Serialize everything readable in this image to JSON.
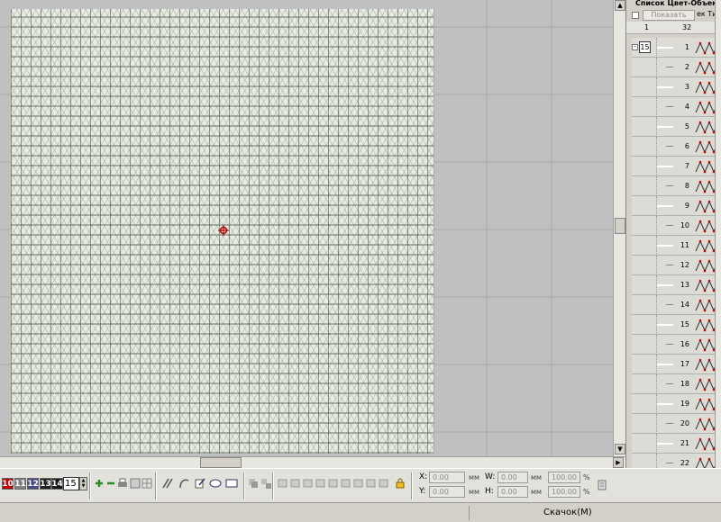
{
  "panel": {
    "title": "Список Цвет-Объект",
    "show_button": "Показать",
    "tab_label": "ек Ти",
    "header_col1": "1",
    "header_col2": "32",
    "group_number": "15",
    "group_expander": "-",
    "rows": [
      "1",
      "2",
      "3",
      "4",
      "5",
      "6",
      "7",
      "8",
      "9",
      "10",
      "11",
      "12",
      "13",
      "14",
      "15",
      "16",
      "17",
      "18",
      "19",
      "20",
      "21",
      "22"
    ]
  },
  "toolbar": {
    "color_numbers": [
      "10",
      "11",
      "12",
      "13",
      "14"
    ],
    "color_hex": [
      "#c00000",
      "#808080",
      "#4a4a88",
      "#202020",
      "#1a1a1a"
    ],
    "spin_value": "15",
    "x_label": "X:",
    "y_label": "Y:",
    "w_label": "W:",
    "h_label": "H:",
    "x_value": "0.00",
    "y_value": "0.00",
    "w_value": "0.00",
    "h_value": "0.00",
    "unit_mm": "мм",
    "w_percent": "100.00",
    "h_percent": "100.00",
    "unit_percent": "%"
  },
  "icons": [
    "add-icon",
    "remove-icon",
    "print-icon",
    "grid-icon",
    "parallel-lines-icon",
    "curve-icon",
    "edit-shape-icon",
    "ellipse-icon",
    "rectangle-icon",
    "align-icon",
    "lock-icon"
  ],
  "status": {
    "text": "Скачок(M)"
  }
}
